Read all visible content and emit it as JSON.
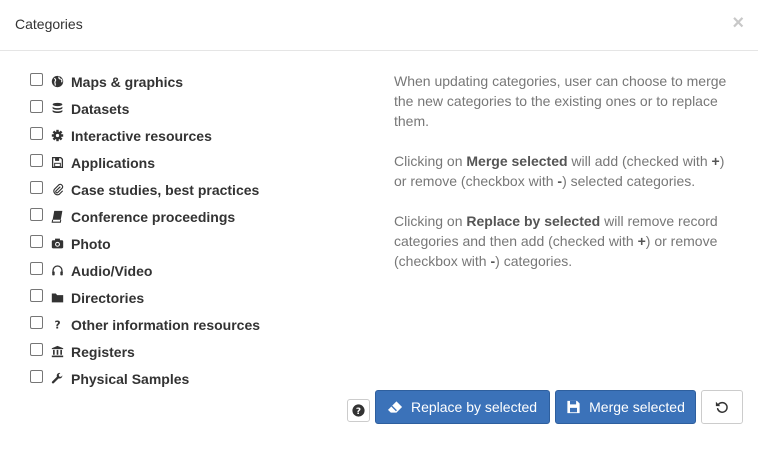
{
  "dialog": {
    "title": "Categories",
    "close_glyph": "×"
  },
  "categories": [
    {
      "label": "Maps & graphics",
      "icon": "globe-icon"
    },
    {
      "label": "Datasets",
      "icon": "database-icon"
    },
    {
      "label": "Interactive resources",
      "icon": "gear-icon"
    },
    {
      "label": "Applications",
      "icon": "floppy-icon"
    },
    {
      "label": "Case studies, best practices",
      "icon": "paperclip-icon"
    },
    {
      "label": "Conference proceedings",
      "icon": "book-icon"
    },
    {
      "label": "Photo",
      "icon": "camera-icon"
    },
    {
      "label": "Audio/Video",
      "icon": "headphones-icon"
    },
    {
      "label": "Directories",
      "icon": "folder-icon"
    },
    {
      "label": "Other information resources",
      "icon": "question-icon"
    },
    {
      "label": "Registers",
      "icon": "institution-icon"
    },
    {
      "label": "Physical Samples",
      "icon": "wrench-icon"
    }
  ],
  "help": {
    "p1": "When updating categories, user can choose to merge the new categories to the existing ones or to replace them.",
    "p2_prefix": "Clicking on ",
    "p2_bold": "Merge selected",
    "p2_mid": " will add (checked with ",
    "p2_plus": "+",
    "p2_mid2": ") or remove (checkbox with ",
    "p2_minus": "-",
    "p2_suffix": ") selected categories.",
    "p3_prefix": "Clicking on ",
    "p3_bold": "Replace by selected",
    "p3_mid": " will remove record categories and then add (checked with ",
    "p3_plus": "+",
    "p3_mid2": ") or remove (checkbox with ",
    "p3_minus": "-",
    "p3_suffix": ") categories."
  },
  "actions": {
    "help_glyph": "?",
    "replace_label": "Replace by selected",
    "merge_label": "Merge selected"
  },
  "colors": {
    "primary": "#3b72b9",
    "help_text": "#777777"
  }
}
